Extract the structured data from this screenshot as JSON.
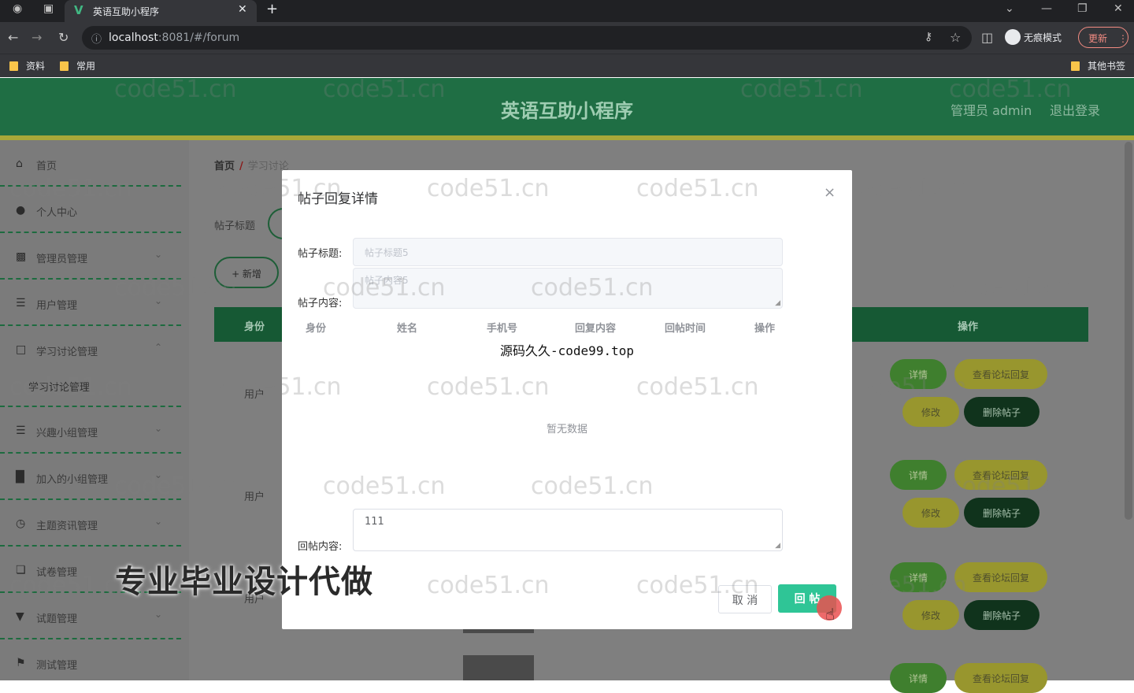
{
  "browser": {
    "tab_title": "英语互助小程序",
    "url_host": "localhost",
    "url_rest": ":8081/#/forum",
    "incognito_label": "无痕模式",
    "update_label": "更新",
    "bookmarks": [
      "资料",
      "常用"
    ],
    "other_bookmarks": "其他书签"
  },
  "header": {
    "title": "英语互助小程序",
    "admin": "管理员 admin",
    "logout": "退出登录"
  },
  "sidebar": {
    "items": [
      {
        "label": "首页",
        "icon": "home-icon"
      },
      {
        "label": "个人中心",
        "icon": "user-icon"
      },
      {
        "label": "管理员管理",
        "icon": "admin-icon"
      },
      {
        "label": "用户管理",
        "icon": "list-icon"
      },
      {
        "label": "学习讨论管理",
        "icon": "forum-icon"
      },
      {
        "label": "兴趣小组管理",
        "icon": "list-icon"
      },
      {
        "label": "加入的小组管理",
        "icon": "chart-icon"
      },
      {
        "label": "主题资讯管理",
        "icon": "clock-icon"
      },
      {
        "label": "试卷管理",
        "icon": "paper-icon"
      },
      {
        "label": "试题管理",
        "icon": "question-icon"
      },
      {
        "label": "测试管理",
        "icon": "flag-icon"
      }
    ],
    "sub_item": "学习讨论管理"
  },
  "main": {
    "breadcrumb_home": "首页",
    "breadcrumb_sep": "/",
    "breadcrumb_current": "学习讨论",
    "filter_label": "帖子标题",
    "add_button": "+ 新增",
    "col_identity": "身份",
    "col_action": "操作",
    "rows": [
      {
        "identity": "用户",
        "detail": "详情",
        "view_replies": "查看论坛回复",
        "edit": "修改",
        "delete": "删除帖子"
      },
      {
        "identity": "用户",
        "detail": "详情",
        "view_replies": "查看论坛回复",
        "edit": "修改",
        "delete": "删除帖子"
      },
      {
        "identity": "用户",
        "detail": "详情",
        "view_replies": "查看论坛回复",
        "edit": "修改",
        "delete": "删除帖子"
      },
      {
        "identity": "",
        "detail": "详情",
        "view_replies": "查看论坛回复",
        "edit": "",
        "delete": ""
      }
    ]
  },
  "modal": {
    "title": "帖子回复详情",
    "post_title_label": "帖子标题:",
    "post_title_value": "帖子标题5",
    "post_content_label": "帖子内容:",
    "post_content_value": "帖子内容5",
    "columns": [
      "身份",
      "姓名",
      "手机号",
      "回复内容",
      "回帖时间",
      "操作"
    ],
    "watermark_line": "源码久久-code99.top",
    "empty_text": "暂无数据",
    "reply_label": "回帖内容:",
    "reply_value": "111",
    "cancel": "取 消",
    "submit": "回 帖"
  },
  "overlay": {
    "watermark": "code51.cn",
    "promo": "专业毕业设计代做"
  },
  "colors": {
    "header_green": "#1f6e44",
    "accent_yellow": "#a8a839",
    "submit_green": "#2fc596"
  }
}
